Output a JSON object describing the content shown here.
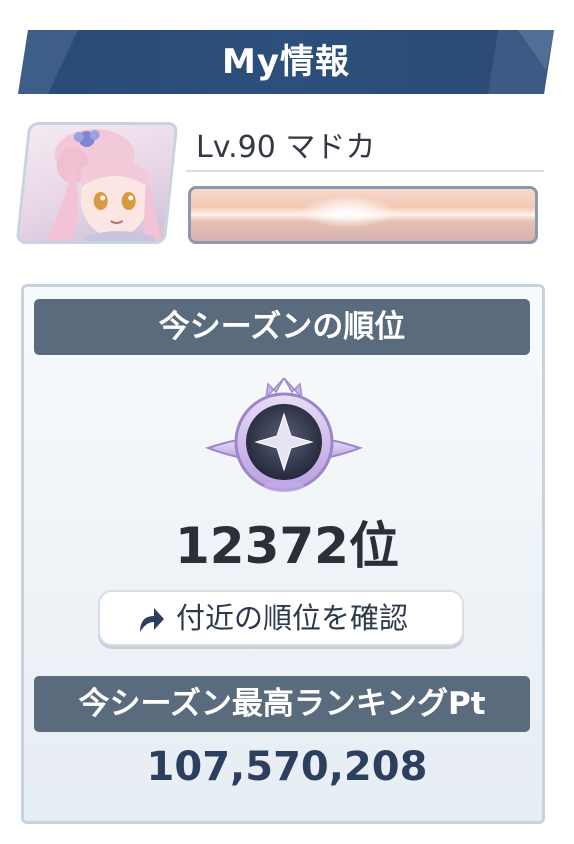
{
  "header": {
    "title": "My情報"
  },
  "profile": {
    "name": "Lv.90 マドカ",
    "avatar_icon": "character-portrait-icon"
  },
  "season_rank": {
    "section_title": "今シーズンの順位",
    "rank": "12372位",
    "emblem_icon": "star-rank-emblem-icon",
    "nearby_button_label": "付近の順位を確認",
    "nearby_button_icon": "share-arrow-icon"
  },
  "ranking_pt": {
    "section_title": "今シーズン最高ランキングPt",
    "value": "107,570,208"
  },
  "colors": {
    "header_blue": "#2b4c78",
    "section_gray": "#5b6b7e",
    "rank_text": "#2b3038",
    "pt_text": "#2d3f5f"
  }
}
